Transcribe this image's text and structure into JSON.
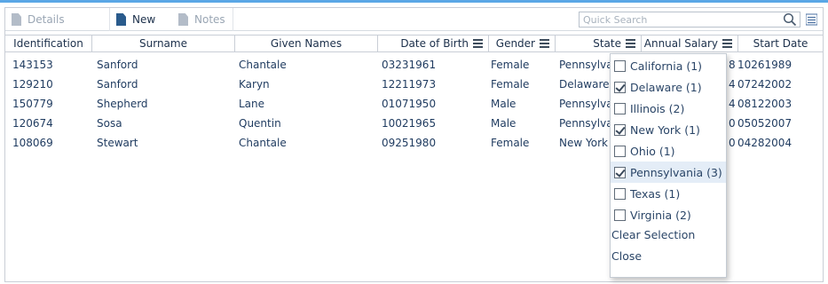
{
  "toolbar": {
    "details_label": "Details",
    "new_label": "New",
    "notes_label": "Notes",
    "search_placeholder": "Quick Search"
  },
  "columns": [
    {
      "label": "Identification"
    },
    {
      "label": "Surname"
    },
    {
      "label": "Given Names"
    },
    {
      "label": "Date of Birth"
    },
    {
      "label": "Gender"
    },
    {
      "label": "State"
    },
    {
      "label": "Annual Salary"
    },
    {
      "label": "Start Date"
    }
  ],
  "rows": [
    {
      "id": "143153",
      "surname": "Sanford",
      "given": "Chantale",
      "dob": "03231961",
      "gender": "Female",
      "state": "Pennsylva",
      "salary": "8",
      "start": "10261989"
    },
    {
      "id": "129210",
      "surname": "Sanford",
      "given": "Karyn",
      "dob": "12211973",
      "gender": "Female",
      "state": "Delaware",
      "salary": "4",
      "start": "07242002"
    },
    {
      "id": "150779",
      "surname": "Shepherd",
      "given": "Lane",
      "dob": "01071950",
      "gender": "Male",
      "state": "Pennsylva",
      "salary": "4",
      "start": "08122003"
    },
    {
      "id": "120674",
      "surname": "Sosa",
      "given": "Quentin",
      "dob": "10021965",
      "gender": "Male",
      "state": "Pennsylva",
      "salary": "0",
      "start": "05052007"
    },
    {
      "id": "108069",
      "surname": "Stewart",
      "given": "Chantale",
      "dob": "09251980",
      "gender": "Female",
      "state": "New York",
      "salary": "0",
      "start": "04282004"
    }
  ],
  "state_filter": {
    "options": [
      {
        "label": "California (1)",
        "checked": false
      },
      {
        "label": "Delaware (1)",
        "checked": true
      },
      {
        "label": "Illinois (2)",
        "checked": false
      },
      {
        "label": "New York (1)",
        "checked": true
      },
      {
        "label": "Ohio (1)",
        "checked": false
      },
      {
        "label": "Pennsylvania (3)",
        "checked": true
      },
      {
        "label": "Texas (1)",
        "checked": false
      },
      {
        "label": "Virginia (2)",
        "checked": false
      }
    ],
    "clear_label": "Clear Selection",
    "close_label": "Close"
  },
  "colors": {
    "accent": "#5aa7e6",
    "text": "#1e3a5f",
    "highlight": "#e4edf7"
  }
}
